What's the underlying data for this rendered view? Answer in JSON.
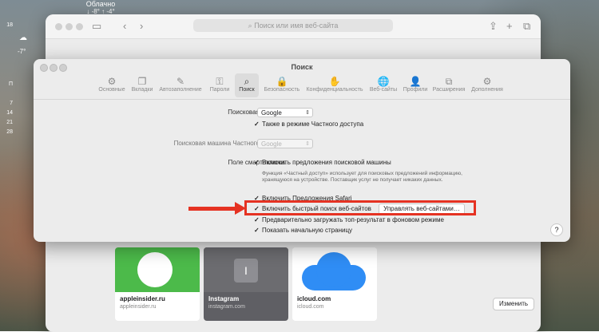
{
  "desktop": {
    "weather": {
      "condition": "Облачно",
      "temps": "↓ -8° ↑ -4°"
    },
    "calendar": {
      "day_letter": "П",
      "days": [
        "18",
        "7",
        "14",
        "21",
        "28"
      ],
      "temp": "-7°"
    }
  },
  "safari": {
    "address_placeholder": "Поиск или имя веб-сайта",
    "tiles": [
      {
        "name": "appleinsider.ru",
        "url": "appleinsider.ru",
        "color": "#4cba4a"
      },
      {
        "name": "Instagram",
        "url": "instagram.com",
        "letter": "I",
        "color": "#8e8e93"
      },
      {
        "name": "icloud.com",
        "url": "icloud.com",
        "color": "#2f8df5"
      }
    ],
    "change_button": "Изменить"
  },
  "prefs": {
    "title": "Поиск",
    "toolbar": [
      {
        "label": "Основные",
        "icon": "gear-icon",
        "glyph": "⚙"
      },
      {
        "label": "Вкладки",
        "icon": "tabs-icon",
        "glyph": "❐"
      },
      {
        "label": "Автозаполнение",
        "icon": "autofill-icon",
        "glyph": "✎"
      },
      {
        "label": "Пароли",
        "icon": "key-icon",
        "glyph": "⚿"
      },
      {
        "label": "Поиск",
        "icon": "search-icon",
        "glyph": "⌕",
        "active": true
      },
      {
        "label": "Безопасность",
        "icon": "lock-icon",
        "glyph": "🔒"
      },
      {
        "label": "Конфиденциальность",
        "icon": "hand-icon",
        "glyph": "✋"
      },
      {
        "label": "Веб-сайты",
        "icon": "globe-icon",
        "glyph": "🌐"
      },
      {
        "label": "Профили",
        "icon": "person-icon",
        "glyph": "👤"
      },
      {
        "label": "Расширения",
        "icon": "puzzle-icon",
        "glyph": "⧉"
      },
      {
        "label": "Дополнения",
        "icon": "gears-icon",
        "glyph": "⚙"
      }
    ],
    "search_engine_label": "Поисковая машина:",
    "search_engine_value": "Google",
    "private_mode_check": "Также в режиме Частного доступа",
    "private_engine_label": "Поисковая машина Частного доступа:",
    "private_engine_value": "Google",
    "smart_field_label": "Поле смарт-поиска:",
    "check_suggestions": "Включить предложения поисковой машины",
    "suggestions_desc": "Функция «Частный доступ» использует для поисковых предложений информацию, хранящуюся на устройстве. Поставщик услуг не получает никаких данных.",
    "check_safari_suggestions": "Включить Предложения Safari",
    "check_quick_search": "Включить быстрый поиск веб-сайтов",
    "manage_sites_button": "Управлять веб-сайтами…",
    "check_preload": "Предварительно загружать топ-результат в фоновом режиме",
    "check_start_page": "Показать начальную страницу",
    "help": "?"
  }
}
